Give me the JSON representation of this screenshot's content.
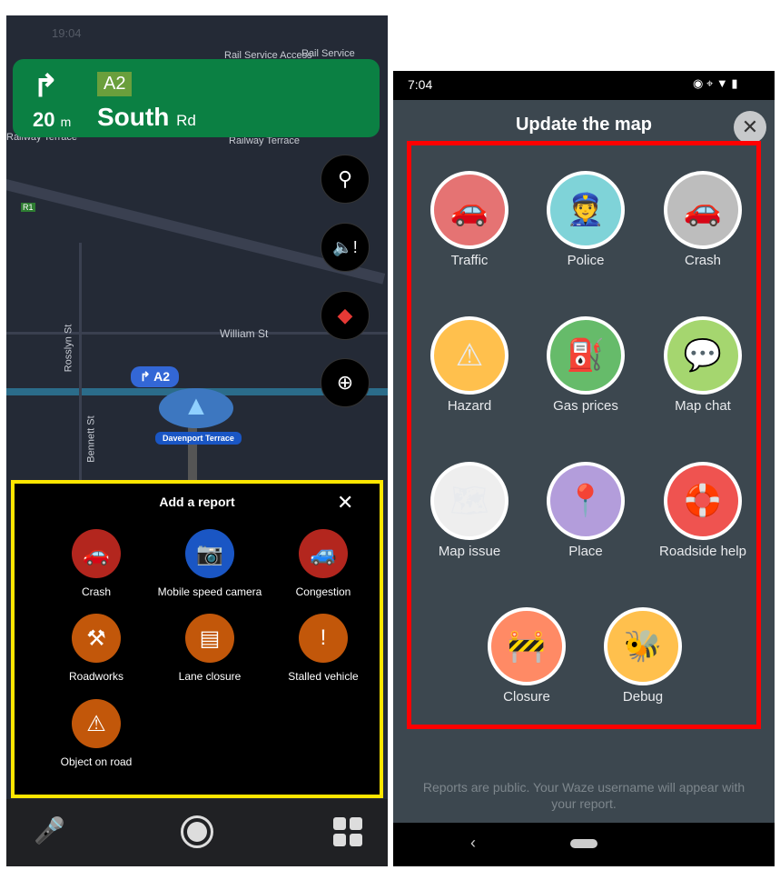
{
  "left": {
    "status_time": "19:04",
    "map_labels": [
      "Rail Service Access",
      "Rail Service Access",
      "Railway Terrace",
      "Railway Terrace",
      "William St",
      "Rosslyn St",
      "Bennett St",
      "R1"
    ],
    "banner": {
      "distance": "20",
      "unit": "m",
      "route_badge": "A2",
      "street": "South",
      "street_suffix": "Rd",
      "color": "#0b8043"
    },
    "route_chip": "A2",
    "current_street": "Davenport Terrace",
    "report": {
      "title": "Add a report",
      "items": [
        {
          "label": "Crash",
          "color": "#b3261e",
          "icon": "crash-icon"
        },
        {
          "label": "Mobile speed camera",
          "color": "#1a56c4",
          "icon": "speed-camera-icon"
        },
        {
          "label": "Congestion",
          "color": "#b3261e",
          "icon": "congestion-icon"
        },
        {
          "label": "Roadworks",
          "color": "#c2570a",
          "icon": "roadworks-icon"
        },
        {
          "label": "Lane closure",
          "color": "#c2570a",
          "icon": "lane-closure-icon"
        },
        {
          "label": "Stalled vehicle",
          "color": "#c2570a",
          "icon": "stalled-vehicle-icon"
        },
        {
          "label": "Object on road",
          "color": "#c2570a",
          "icon": "object-on-road-icon"
        }
      ]
    }
  },
  "right": {
    "status_time": "7:04",
    "title": "Update the map",
    "items": [
      {
        "label": "Traffic",
        "color": "#e57373",
        "icon": "traffic-icon"
      },
      {
        "label": "Police",
        "color": "#7fd3d8",
        "icon": "police-icon"
      },
      {
        "label": "Crash",
        "color": "#bdbdbd",
        "icon": "crash-icon"
      },
      {
        "label": "Hazard",
        "color": "#ffc04d",
        "icon": "hazard-icon"
      },
      {
        "label": "Gas prices",
        "color": "#66bb6a",
        "icon": "gas-icon"
      },
      {
        "label": "Map chat",
        "color": "#a5d66f",
        "icon": "chat-icon"
      },
      {
        "label": "Map issue",
        "color": "#eeeeee",
        "icon": "map-issue-icon"
      },
      {
        "label": "Place",
        "color": "#b39ddb",
        "icon": "place-icon"
      },
      {
        "label": "Roadside help",
        "color": "#ef5350",
        "icon": "roadside-help-icon"
      },
      {
        "label": "Closure",
        "color": "#ff8a65",
        "icon": "closure-icon"
      },
      {
        "label": "Debug",
        "color": "#ffc04d",
        "icon": "debug-icon"
      }
    ],
    "footer": "Reports are public. Your Waze username will appear with your report."
  }
}
